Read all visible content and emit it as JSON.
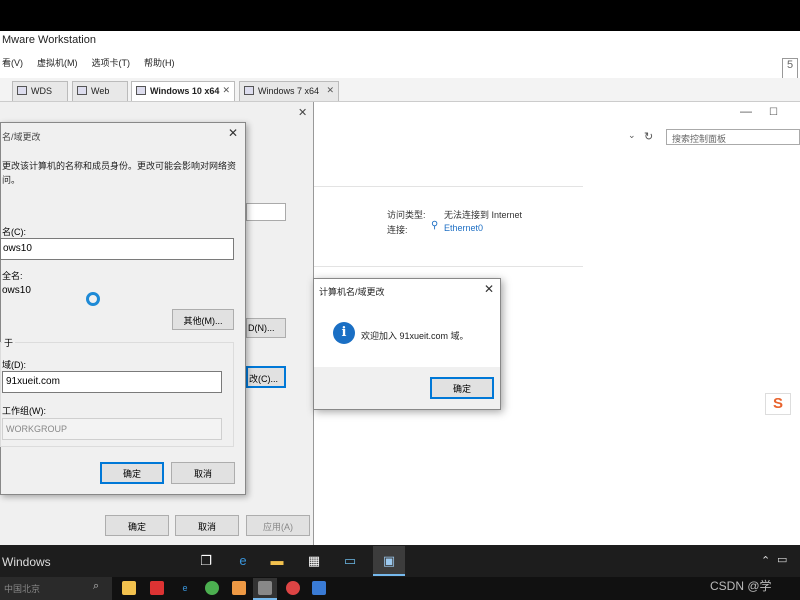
{
  "vmware": {
    "title": "Mware Workstation",
    "menu": [
      "看(V)",
      "虚拟机(M)",
      "选项卡(T)",
      "帮助(H)"
    ],
    "tabs": [
      {
        "label": "WDS",
        "active": false
      },
      {
        "label": "Web",
        "active": false
      },
      {
        "label": "Windows 10 x64",
        "active": true
      },
      {
        "label": "Windows 7 x64",
        "active": false
      }
    ]
  },
  "control_panel": {
    "search_placeholder": "搜索控制面板",
    "access_type_label": "访问类型:",
    "access_type_value": "无法连接到 Internet",
    "connection_label": "连接:",
    "connection_value": "Ethernet0"
  },
  "system_properties": {
    "btn_change_domain": "D(N)...",
    "btn_change": "改(C)...",
    "ok": "确定",
    "cancel": "取消",
    "apply": "应用(A)"
  },
  "name_change_dialog": {
    "title": "名/域更改",
    "description_line1": "更改该计算机的名称和成员身份。更改可能会影响对网络资",
    "description_line2": "问。",
    "computer_name_label": "名(C):",
    "computer_name_value": "ows10",
    "full_name_label": "全名:",
    "full_name_value": "ows10",
    "other_button": "其他(M)...",
    "member_of_label": "于",
    "domain_label": "域(D):",
    "domain_value": "91xueit.com",
    "workgroup_label": "工作组(W):",
    "workgroup_value": "WORKGROUP",
    "ok": "确定",
    "cancel": "取消"
  },
  "welcome_dialog": {
    "title": "计算机名/域更改",
    "message": "欢迎加入 91xueit.com 域。",
    "ok": "确定"
  },
  "ime": {
    "label": "S"
  },
  "guest_taskbar": {
    "activate_text": "Windows"
  },
  "host_taskbar": {
    "search_text": "中国北京",
    "watermark": "CSDN @学"
  }
}
